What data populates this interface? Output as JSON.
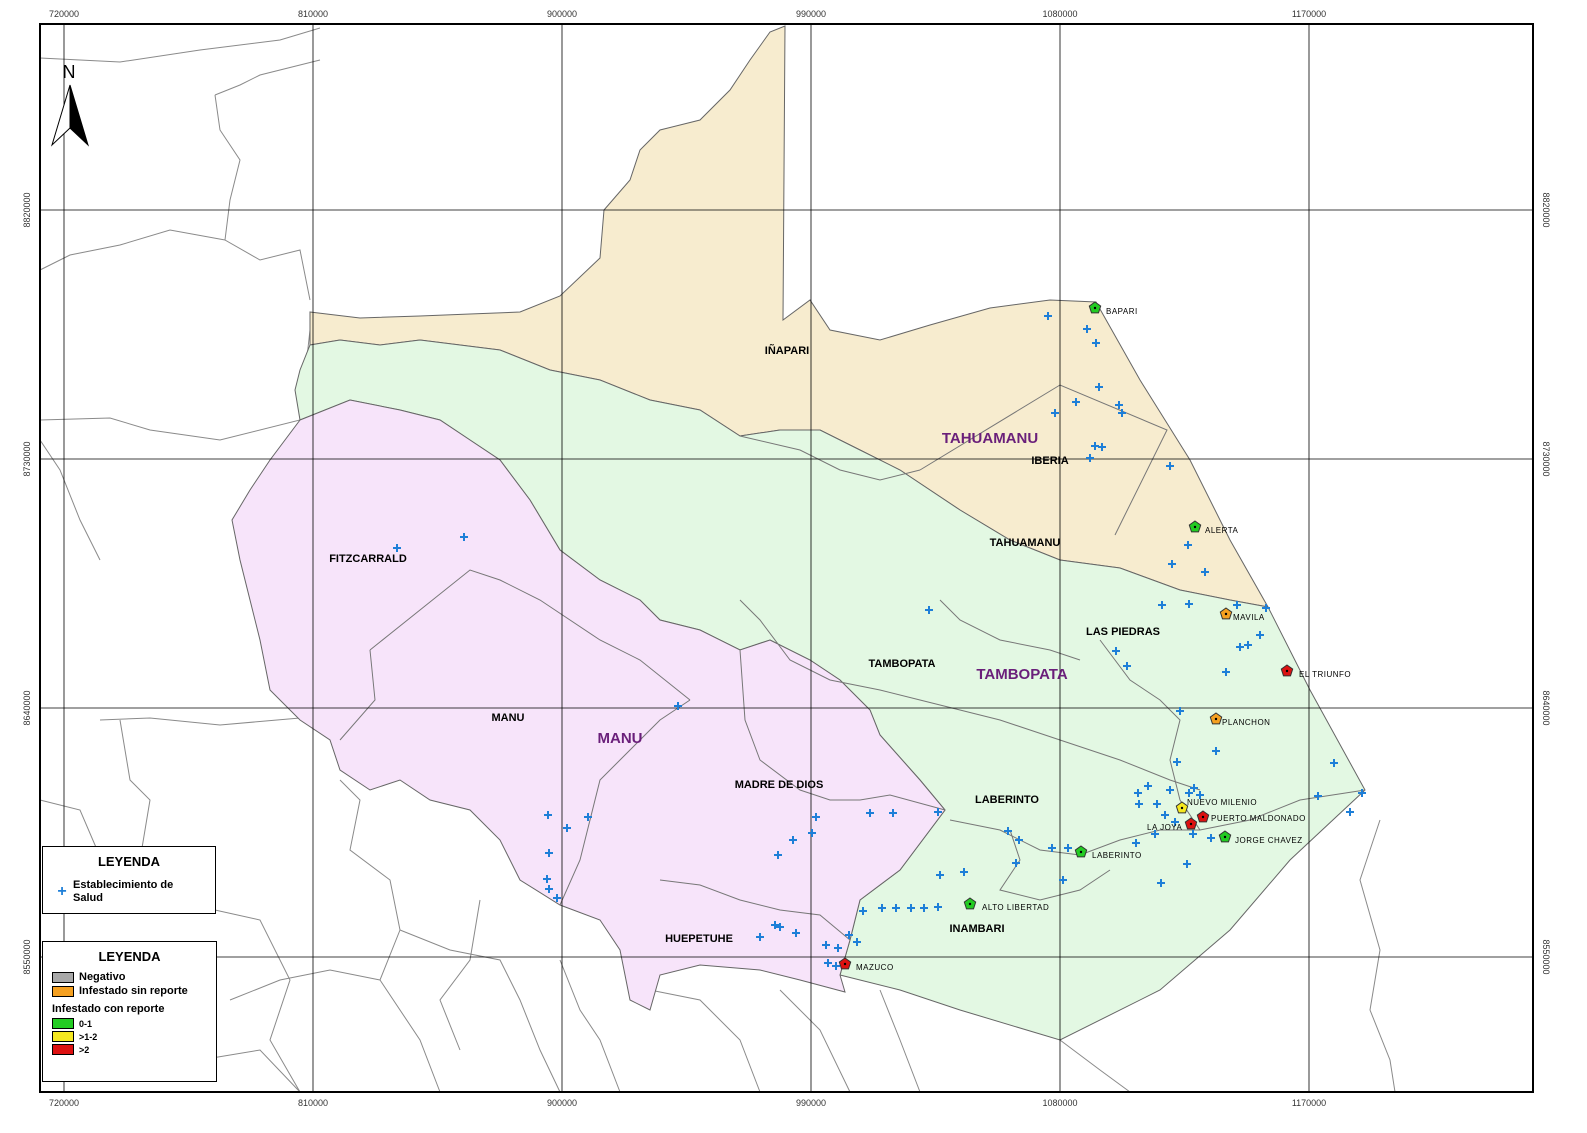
{
  "axes": {
    "x_ticks": [
      "720000",
      "810000",
      "900000",
      "990000",
      "1080000",
      "1170000"
    ],
    "y_ticks": [
      "8820000",
      "8730000",
      "8640000",
      "8550000"
    ]
  },
  "north_arrow": {
    "label": "N"
  },
  "regions": [
    {
      "name": "TAHUAMANU",
      "color": "#f7eccf"
    },
    {
      "name": "TAMBOPATA",
      "color": "#e3f8e3"
    },
    {
      "name": "MANU",
      "color": "#f7e4fa"
    }
  ],
  "districts": [
    "IÑAPARI",
    "IBERIA",
    "TAHUAMANU",
    "FITZCARRALD",
    "LAS PIEDRAS",
    "TAMBOPATA",
    "MANU",
    "MADRE DE DIOS",
    "LABERINTO",
    "HUEPETUHE",
    "INAMBARI"
  ],
  "localities": [
    {
      "name": "BAPARI",
      "class": "0-1",
      "color": "#22cc22"
    },
    {
      "name": "ALERTA",
      "class": "0-1",
      "color": "#22cc22"
    },
    {
      "name": "MAVILA",
      "class": "Infestado sin reporte",
      "color": "#f5a020"
    },
    {
      "name": "EL TRIUNFO",
      "class": ">2",
      "color": "#dd1111"
    },
    {
      "name": "PLANCHON",
      "class": "Infestado sin reporte",
      "color": "#f5a020"
    },
    {
      "name": "NUEVO MILENIO",
      "class": ">1-2",
      "color": "#f5e820"
    },
    {
      "name": "PUERTO MALDONADO",
      "class": ">2",
      "color": "#dd1111"
    },
    {
      "name": "LA JOYA",
      "class": ">2",
      "color": "#dd1111"
    },
    {
      "name": "JORGE CHAVEZ",
      "class": "0-1",
      "color": "#22cc22"
    },
    {
      "name": "LABERINTO",
      "class": "0-1",
      "color": "#22cc22"
    },
    {
      "name": "ALTO LIBERTAD",
      "class": "0-1",
      "color": "#22cc22"
    },
    {
      "name": "MAZUCO",
      "class": ">2",
      "color": "#dd1111"
    }
  ],
  "legend1": {
    "title": "LEYENDA",
    "item": "Establecimiento de Salud",
    "symbol_color": "#1e7fd8"
  },
  "legend2": {
    "title": "LEYENDA",
    "negativo": "Negativo",
    "infestado_sin_reporte": "Infestado sin reporte",
    "infestado_con_reporte": "Infestado con reporte",
    "class1": "0-1",
    "class2": ">1-2",
    "class3": ">2",
    "colors": {
      "negativo": "#a8a8a8",
      "sin_reporte": "#f5a020",
      "class1": "#22cc22",
      "class2": "#f5e820",
      "class3": "#dd1111"
    }
  }
}
